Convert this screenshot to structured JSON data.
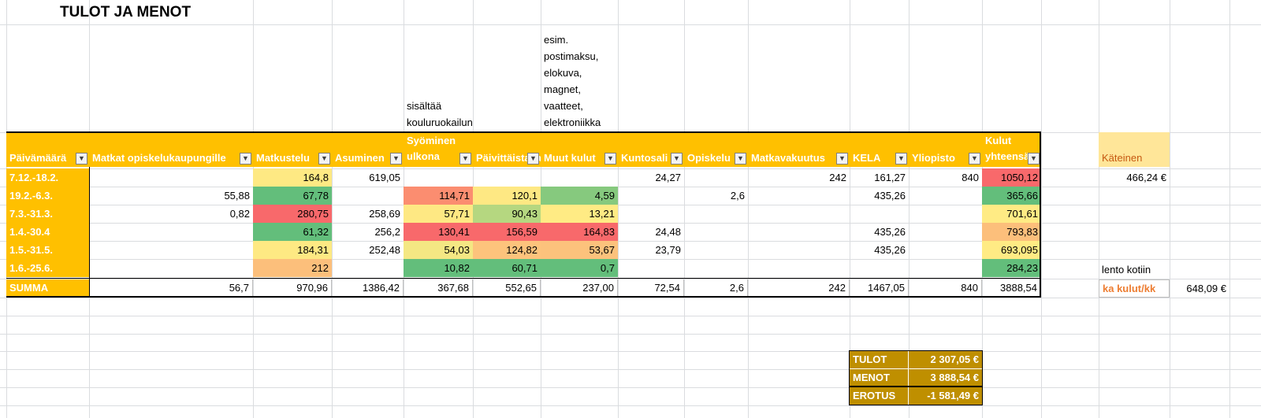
{
  "title": "TULOT JA MENOT",
  "notes": {
    "syominen": "sisältää kouluruokailun",
    "muut": "esim. postimaksu, elokuva, magnet, vaatteet, elektroniikka"
  },
  "headers": [
    {
      "label": "Päivämäärä",
      "filter": "▼"
    },
    {
      "label": "Matkat opiskelukaupungille",
      "filter": "▼"
    },
    {
      "label": "Matkustelu",
      "filter": "▼"
    },
    {
      "label": "Asuminen",
      "filter": "▼"
    },
    {
      "label": "Syöminen ulkona",
      "filter": "▼"
    },
    {
      "label": "Päivittäistavarat",
      "filter": "▼"
    },
    {
      "label": "Muut kulut",
      "filter": "▼"
    },
    {
      "label": "Kuntosali",
      "filter": "▼"
    },
    {
      "label": "Opiskelu",
      "filter": "▼"
    },
    {
      "label": "Matkavakuutus",
      "filter": "▼"
    },
    {
      "label": "KELA",
      "filter": "▼"
    },
    {
      "label": "Yliopisto",
      "filter": "▼"
    },
    {
      "label": "Kulut yhteensä",
      "filter": "▼"
    }
  ],
  "rows": [
    {
      "date": "7.12.-18.2.",
      "cells": [
        "",
        "164,8",
        "619,05",
        "",
        "",
        "",
        "24,27",
        "",
        "242",
        "161,27",
        "840",
        "1050,12"
      ]
    },
    {
      "date": "19.2.-6.3.",
      "cells": [
        "55,88",
        "67,78",
        "",
        "114,71",
        "120,1",
        "4,59",
        "",
        "2,6",
        "",
        "435,26",
        "",
        "365,66"
      ]
    },
    {
      "date": "7.3.-31.3.",
      "cells": [
        "0,82",
        "280,75",
        "258,69",
        "57,71",
        "90,43",
        "13,21",
        "",
        "",
        "",
        "",
        "",
        "701,61"
      ]
    },
    {
      "date": "1.4.-30.4",
      "cells": [
        "",
        "61,32",
        "256,2",
        "130,41",
        "156,59",
        "164,83",
        "24,48",
        "",
        "",
        "435,26",
        "",
        "793,83"
      ]
    },
    {
      "date": "1.5.-31.5.",
      "cells": [
        "",
        "184,31",
        "252,48",
        "54,03",
        "124,82",
        "53,67",
        "23,79",
        "",
        "",
        "435,26",
        "",
        "693,095"
      ]
    },
    {
      "date": "1.6.-25.6.",
      "cells": [
        "",
        "212",
        "",
        "10,82",
        "60,71",
        "0,7",
        "",
        "",
        "",
        "",
        "",
        "284,23"
      ]
    }
  ],
  "summary": {
    "label": "SUMMA",
    "cells": [
      "56,7",
      "970,96",
      "1386,42",
      "367,68",
      "552,65",
      "237,00",
      "72,54",
      "2,6",
      "242",
      "1467,05",
      "840",
      "3888,54"
    ]
  },
  "heat_colors": [
    [
      "",
      "#fee983",
      "",
      "",
      "",
      "",
      "",
      "",
      "",
      "",
      "",
      "#f8696b"
    ],
    [
      "",
      "#63be7b",
      "",
      "#fb8d70",
      "#fee883",
      "#86c97e",
      "",
      "",
      "",
      "",
      "",
      "#63be7b"
    ],
    [
      "",
      "#f8696b",
      "",
      "#fee883",
      "#b5d780",
      "#ffeb84",
      "",
      "",
      "",
      "",
      "",
      "#ffeb84"
    ],
    [
      "",
      "#63be7b",
      "",
      "#f8696b",
      "#f8696b",
      "#f8696b",
      "",
      "",
      "",
      "",
      "",
      "#fcbf7b"
    ],
    [
      "",
      "#fee983",
      "",
      "#f4e783",
      "#fdc37c",
      "#fcc27c",
      "",
      "",
      "",
      "",
      "",
      "#ffeb84"
    ],
    [
      "",
      "#fcbf7b",
      "",
      "#63be7b",
      "#63be7b",
      "#63be7b",
      "",
      "",
      "",
      "",
      "",
      "#63be7b"
    ]
  ],
  "side": {
    "kateinen_label": "Käteinen",
    "kateinen_value": "466,24 €",
    "lento_note": "lento kotiin",
    "ka_label": "ka kulut/kk",
    "ka_value": "648,09 €"
  },
  "finance": [
    {
      "label": "TULOT",
      "value": "2 307,05 €"
    },
    {
      "label": "MENOT",
      "value": "3 888,54 €"
    },
    {
      "label": "EROTUS",
      "value": "-1 581,49 €"
    }
  ]
}
